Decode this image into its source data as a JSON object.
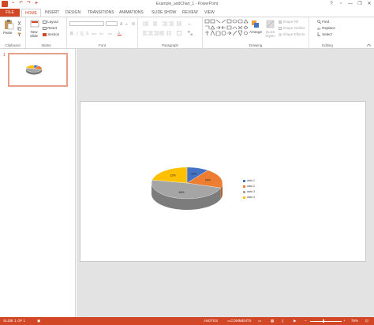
{
  "window": {
    "title": "Example_addChart_1 - PowerPoint",
    "minimize_glyph": "—",
    "restore_glyph": "❐",
    "close_glyph": "✕"
  },
  "quick_access": [
    "save-icon",
    "undo-icon",
    "redo-icon",
    "start-from-beginning-icon"
  ],
  "tabs": {
    "file": "FILE",
    "home": "HOME",
    "insert": "INSERT",
    "design": "DESIGN",
    "transitions": "TRANSITIONS",
    "animations": "ANIMATIONS",
    "slideshow": "SLIDE SHOW",
    "review": "REVIEW",
    "view": "VIEW"
  },
  "ribbon": {
    "clipboard": {
      "label": "Clipboard",
      "paste": "Paste"
    },
    "slides": {
      "label": "Slides",
      "new_slide": "New Slide",
      "layout": "Layout",
      "reset": "Reset",
      "section": "Section"
    },
    "font": {
      "label": "Font"
    },
    "paragraph": {
      "label": "Paragraph"
    },
    "drawing": {
      "label": "Drawing",
      "arrange": "Arrange",
      "quick_styles": "Quick Styles",
      "shape_fill": "Shape Fill",
      "shape_outline": "Shape Outline",
      "shape_effects": "Shape Effects"
    },
    "editing": {
      "label": "Editing",
      "find": "Find",
      "replace": "Replace",
      "select": "Select"
    }
  },
  "thumbnail": {
    "number": "1"
  },
  "chart_data": {
    "type": "pie",
    "subtype": "3d-pie",
    "categories": [
      "data 1",
      "data 2",
      "data 3",
      "data 4"
    ],
    "values": [
      10,
      20,
      48,
      22
    ],
    "labels": [
      "10%",
      "20%",
      "48%",
      "22%"
    ],
    "colors": [
      "#4472c4",
      "#ed7d31",
      "#a5a5a5",
      "#ffc000"
    ],
    "legend_position": "right"
  },
  "status": {
    "slide_info": "SLIDE 1 OF 1",
    "notes": "NOTES",
    "comments": "COMMENTS",
    "zoom": "75%"
  },
  "colors": {
    "accent": "#d24726"
  }
}
